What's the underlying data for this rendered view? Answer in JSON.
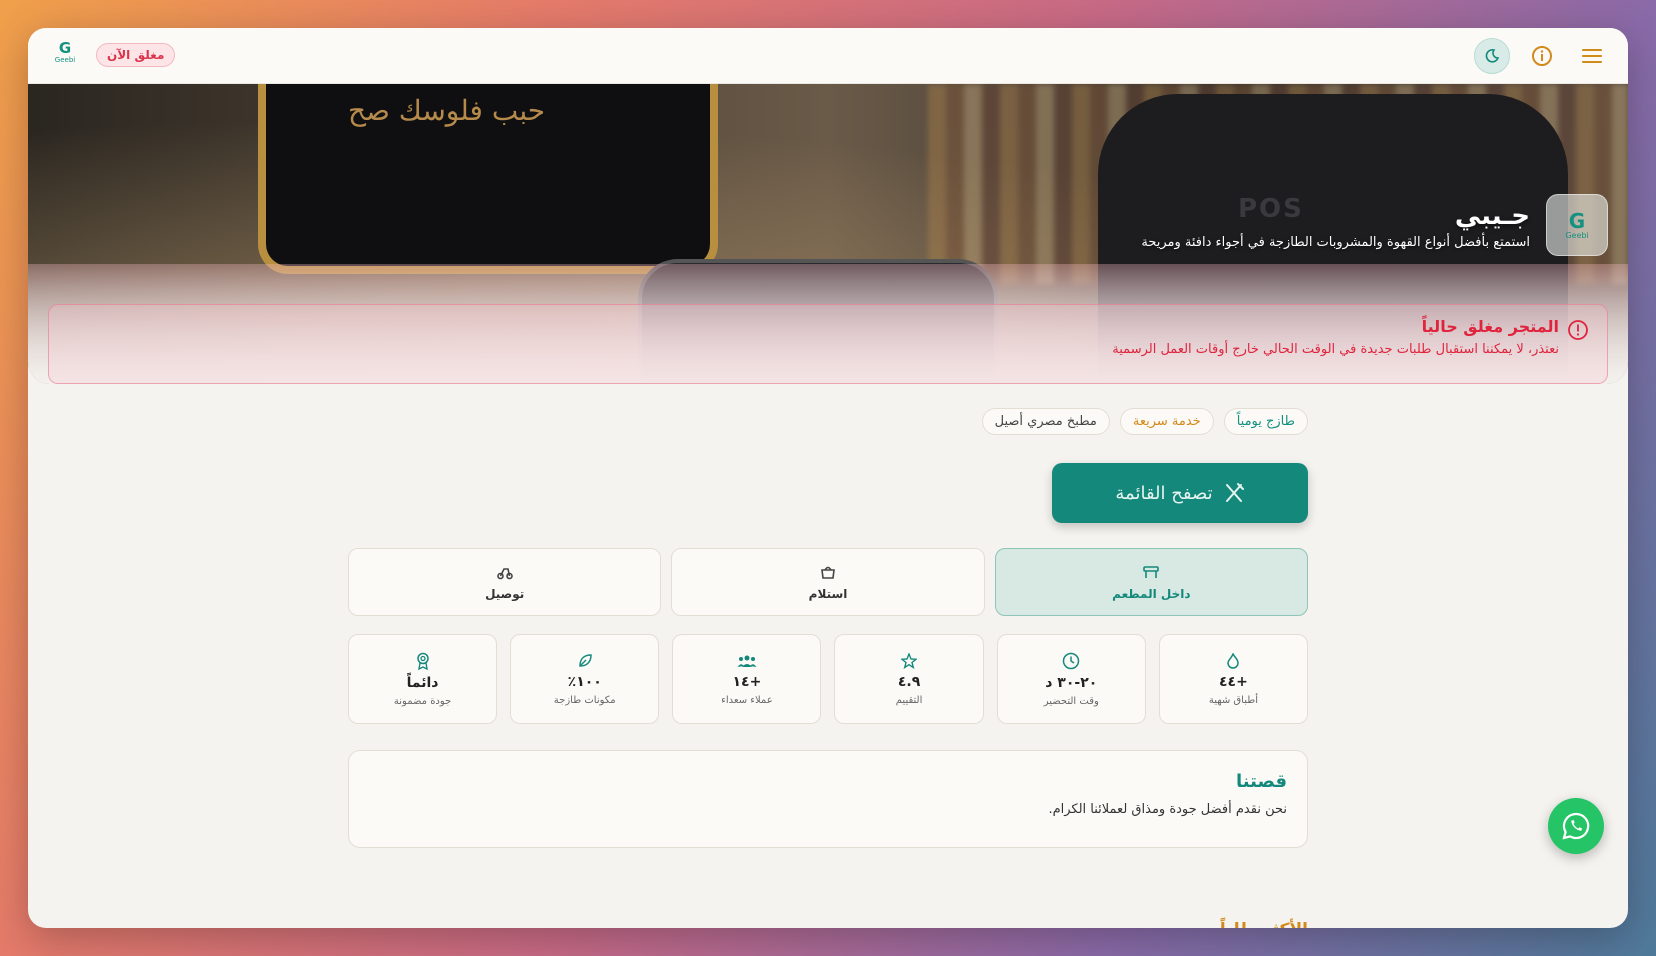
{
  "topbar": {
    "status_label": "مغلق الآن",
    "logo_letter": "G",
    "logo_text": "Geebi"
  },
  "hero": {
    "screen_text": "حبب فلوسك صح",
    "pos_label": "POS"
  },
  "store": {
    "name": "جـيبي",
    "description": "استمتع بأفضل أنواع القهوة والمشروبات الطازجة في أجواء دافئة ومريحة",
    "logo_letter": "G",
    "logo_text": "Geebi"
  },
  "alert": {
    "title": "المتجر مغلق حالياً",
    "message": "نعتذر، لا يمكننا استقبال طلبات جديدة في الوقت الحالي خارج أوقات العمل الرسمية"
  },
  "tags": [
    {
      "label": "طازج يومياً"
    },
    {
      "label": "خدمة سريعة"
    },
    {
      "label": "مطبخ مصري أصيل"
    }
  ],
  "browse_button": "تصفح القائمة",
  "modes": [
    {
      "label": "داخل المطعم",
      "icon": "dine-in-icon"
    },
    {
      "label": "استلام",
      "icon": "pickup-icon"
    },
    {
      "label": "توصيل",
      "icon": "delivery-icon"
    }
  ],
  "stats": [
    {
      "value": "+٤٤",
      "label": "أطباق شهية",
      "icon": "flame-icon"
    },
    {
      "value": "٢٠-٣٠ د",
      "label": "وقت التحضير",
      "icon": "clock-icon"
    },
    {
      "value": "٤.٩",
      "label": "التقييم",
      "icon": "star-icon"
    },
    {
      "value": "+١٤",
      "label": "عملاء سعداء",
      "icon": "users-icon"
    },
    {
      "value": "١٠٠٪",
      "label": "مكونات طازجة",
      "icon": "leaf-icon"
    },
    {
      "value": "دائماً",
      "label": "جودة مضمونة",
      "icon": "award-icon"
    }
  ],
  "story": {
    "title": "قصتنا",
    "text": "نحن نقدم أفضل جودة ومذاق لعملائنا الكرام."
  },
  "most_ordered": "الأكثر طلباً",
  "colors": {
    "primary": "#14897b",
    "accent": "#d28a1b",
    "danger": "#e0243e"
  }
}
